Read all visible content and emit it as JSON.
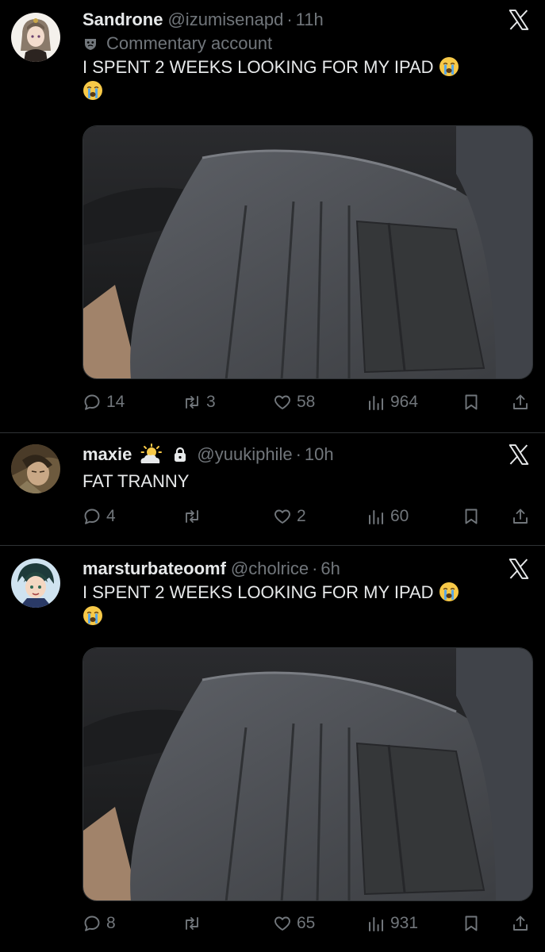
{
  "tweets": [
    {
      "name": "Sandrone",
      "handle": "@izumisenapd",
      "dot": "·",
      "time": "11h",
      "label": "Commentary account",
      "text": "I SPENT 2 WEEKS LOOKING FOR MY IPAD",
      "replies": "14",
      "retweets": "3",
      "likes": "58",
      "views": "964"
    },
    {
      "name": "maxie",
      "handle": "@yuukiphile",
      "dot": "·",
      "time": "10h",
      "text": "FAT TRANNY",
      "replies": "4",
      "retweets": "",
      "likes": "2",
      "views": "60"
    },
    {
      "name": "marsturbateoomf",
      "handle": "@cholrice",
      "dot": "·",
      "time": "6h",
      "text": "I SPENT 2 WEEKS LOOKING FOR MY IPAD",
      "replies": "8",
      "retweets": "",
      "likes": "65",
      "views": "931"
    }
  ],
  "colors": {
    "background": "#000000",
    "text": "#e7e9ea",
    "muted": "#71767b",
    "divider": "#2f3336",
    "emoji": "#f7c948"
  },
  "icons": [
    "x-logo-icon",
    "reply-icon",
    "retweet-icon",
    "like-icon",
    "views-icon",
    "bookmark-icon",
    "share-icon",
    "commentary-mask-icon",
    "sun-cloud-icon",
    "lock-icon",
    "crying-emoji-icon"
  ]
}
